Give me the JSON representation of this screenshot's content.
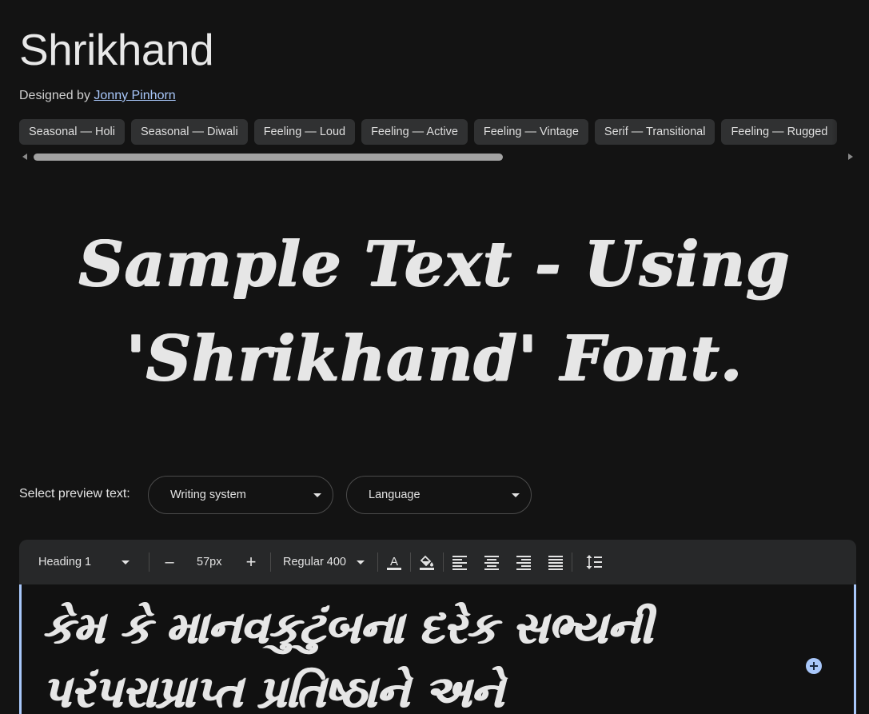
{
  "font": {
    "name": "Shrikhand",
    "designed_by_label": "Designed by",
    "designer": "Jonny Pinhorn"
  },
  "tags": [
    "Seasonal — Holi",
    "Seasonal — Diwali",
    "Feeling — Loud",
    "Feeling — Active",
    "Feeling — Vintage",
    "Serif — Transitional",
    "Feeling — Rugged"
  ],
  "sample": {
    "line1": "Sample Text - Using",
    "line2": "'Shrikhand' Font."
  },
  "preview": {
    "label": "Select preview text:",
    "writing_system": "Writing system",
    "language": "Language"
  },
  "toolbar": {
    "style": "Heading 1",
    "decrease": "–",
    "size": "57px",
    "increase": "+",
    "weight": "Regular 400",
    "icons": {
      "text_color": "text-color-icon",
      "highlight": "fill-color-icon",
      "align_left": "align-left-icon",
      "align_center": "align-center-icon",
      "align_right": "align-right-icon",
      "align_justify": "align-justify-icon",
      "line_height": "line-height-icon"
    }
  },
  "editor": {
    "line1": "કેમ કે માનવકુટુંબના દરેક સભ્યની",
    "line2": "પરંપરાપ્રાપ્ત પ્રતિષ્ઠાને અને"
  },
  "colors": {
    "background": "#131313",
    "accent": "#a8c7fa",
    "chip": "#303132",
    "toolbar": "#272829"
  }
}
